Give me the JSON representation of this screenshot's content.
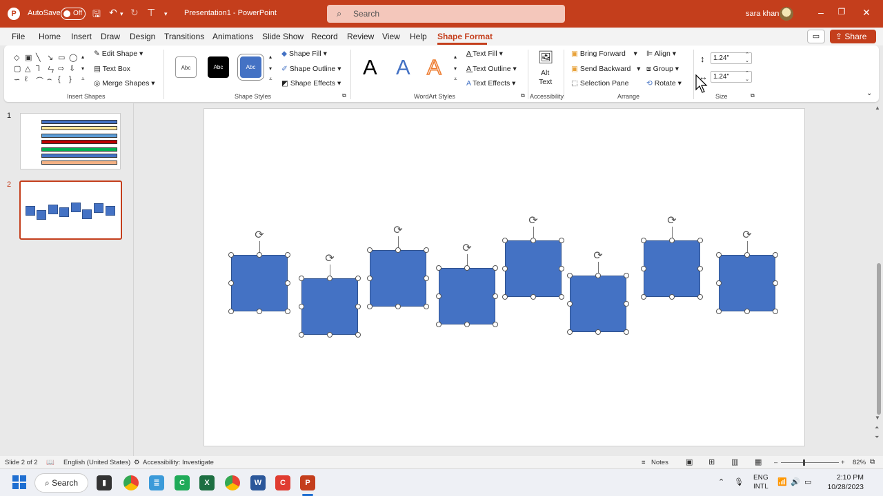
{
  "titlebar": {
    "autosave_label": "AutoSave",
    "autosave_state": "Off",
    "doc_title": "Presentation1  -  PowerPoint",
    "search_placeholder": "Search",
    "user_name": "sara khan"
  },
  "tabs": [
    "File",
    "Home",
    "Insert",
    "Draw",
    "Design",
    "Transitions",
    "Animations",
    "Slide Show",
    "Record",
    "Review",
    "View",
    "Help",
    "Shape Format"
  ],
  "active_tab": "Shape Format",
  "share_label": "Share",
  "ribbon": {
    "insert_shapes": {
      "label": "Insert Shapes",
      "edit_shape": "Edit Shape",
      "text_box": "Text Box",
      "merge_shapes": "Merge Shapes"
    },
    "shape_styles": {
      "label": "Shape Styles",
      "swatch_text": "Abc",
      "shape_fill": "Shape Fill",
      "shape_outline": "Shape Outline",
      "shape_effects": "Shape Effects"
    },
    "wordart": {
      "label": "WordArt Styles",
      "letter": "A",
      "text_fill": "Text Fill",
      "text_outline": "Text Outline",
      "text_effects": "Text Effects"
    },
    "accessibility": {
      "label": "Accessibility",
      "alt_text_1": "Alt",
      "alt_text_2": "Text"
    },
    "arrange": {
      "label": "Arrange",
      "bring_forward": "Bring Forward",
      "send_backward": "Send Backward",
      "selection_pane": "Selection Pane",
      "align": "Align",
      "group": "Group",
      "rotate": "Rotate"
    },
    "size": {
      "label": "Size",
      "height": "1.24\"",
      "width": "1.24\""
    }
  },
  "thumbnails": [
    {
      "number": "1",
      "bar_colors": [
        "#4472c4",
        "#ffe699",
        "#5b9bd5",
        "#c00000",
        "#00b050",
        "#4472c4",
        "#f4b183"
      ]
    },
    {
      "number": "2"
    }
  ],
  "colors": {
    "accent": "#c43e1c",
    "shape_fill": "#4472c4",
    "shape_border": "#2f528f"
  },
  "status": {
    "slide_info": "Slide 2 of 2",
    "language": "English (United States)",
    "accessibility": "Accessibility: Investigate",
    "notes": "Notes",
    "zoom": "82%"
  },
  "taskbar": {
    "search_label": "Search",
    "lang_1": "ENG",
    "lang_2": "INTL",
    "time": "2:10 PM",
    "date": "10/28/2023"
  }
}
